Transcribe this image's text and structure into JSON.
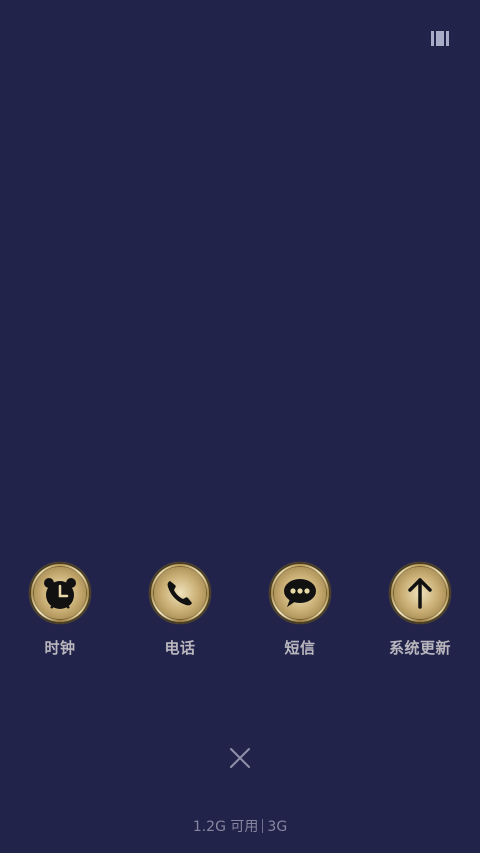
{
  "apps": [
    {
      "label": "时钟",
      "icon": "alarm-clock-icon"
    },
    {
      "label": "电话",
      "icon": "phone-icon"
    },
    {
      "label": "短信",
      "icon": "message-icon"
    },
    {
      "label": "系统更新",
      "icon": "arrow-up-icon"
    }
  ],
  "top_icon": "multi-window-icon",
  "close_icon": "close-icon",
  "memory": {
    "available": "1.2G 可用",
    "total": "3G"
  },
  "colors": {
    "background": "#21234b",
    "label": "#b9b7bd",
    "memory_text": "#85879f",
    "gold": "#cdb37a"
  }
}
